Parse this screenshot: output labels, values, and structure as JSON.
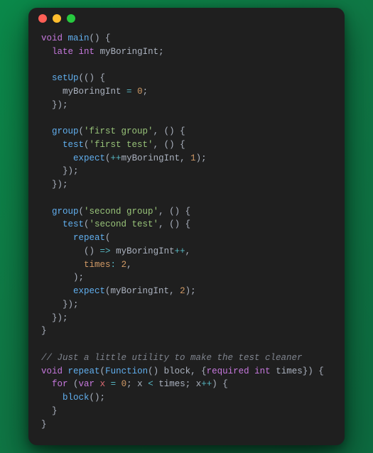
{
  "tokens": {
    "kw_void": "void",
    "kw_late": "late",
    "kw_int": "int",
    "kw_var": "var",
    "kw_for": "for",
    "kw_required": "required",
    "fn_main": "main",
    "fn_setUp": "setUp",
    "fn_group": "group",
    "fn_test": "test",
    "fn_expect": "expect",
    "fn_repeat": "repeat",
    "fn_block": "block",
    "fn_Function": "Function",
    "id_myBoringInt": "myBoringInt",
    "id_x": "x",
    "id_times": "times",
    "str_first_group": "'first group'",
    "str_first_test": "'first test'",
    "str_second_group": "'second group'",
    "str_second_test": "'second test'",
    "num_0": "0",
    "num_1": "1",
    "num_2": "2",
    "comment": "// Just a little utility to make the test cleaner",
    "label_times": "times"
  }
}
